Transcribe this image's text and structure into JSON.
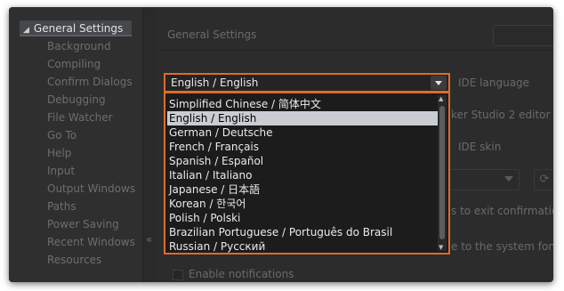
{
  "sidebar": {
    "root_label": "General Settings",
    "items": [
      "Background",
      "Compiling",
      "Confirm Dialogs",
      "Debugging",
      "File Watcher",
      "Go To",
      "Help",
      "Input",
      "Output Windows",
      "Paths",
      "Power Saving",
      "Recent Windows",
      "Resources"
    ],
    "collapse_glyph": "«"
  },
  "main": {
    "title": "General Settings",
    "labels": {
      "ide_language": "IDE language",
      "studio_editor": "ker Studio 2 editor",
      "ide_skin": "IDE skin",
      "exit_confirm": "s to exit confirmatio",
      "system_font": "e to the system font",
      "notifications": "Enable notifications"
    }
  },
  "dropdown": {
    "selected": "English / English",
    "options": [
      "Simplified Chinese / 简体中文",
      "English / English",
      "German / Deutsche",
      "French / Français",
      "Spanish / Español",
      "Italian / Italiano",
      "Japanese / 日本語",
      "Korean / 한국어",
      "Polish / Polski",
      "Brazilian Portuguese / Português do Brasil",
      "Russian / Русский"
    ],
    "highlight_color": "#e06a2a"
  }
}
